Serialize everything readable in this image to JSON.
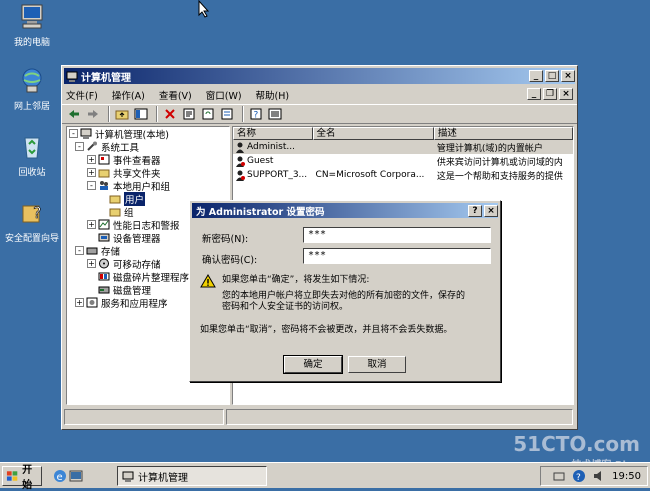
{
  "desktop": {
    "icons": [
      {
        "label": "我的电脑",
        "icon": "my-computer-icon"
      },
      {
        "label": "网上邻居",
        "icon": "network-icon"
      },
      {
        "label": "回收站",
        "icon": "recycle-bin-icon"
      },
      {
        "label": "安全配置向导",
        "icon": "security-wizard-icon"
      }
    ]
  },
  "window": {
    "title": "计算机管理",
    "menu": [
      "文件(F)",
      "操作(A)",
      "查看(V)",
      "窗口(W)",
      "帮助(H)"
    ]
  },
  "tree": {
    "items": [
      {
        "label": "计算机管理(本地)",
        "level": 0,
        "toggle": "-"
      },
      {
        "label": "系统工具",
        "level": 1,
        "toggle": "-"
      },
      {
        "label": "事件查看器",
        "level": 2,
        "toggle": "+"
      },
      {
        "label": "共享文件夹",
        "level": 2,
        "toggle": "+"
      },
      {
        "label": "本地用户和组",
        "level": 2,
        "toggle": "-"
      },
      {
        "label": "用户",
        "level": 3,
        "toggle": "",
        "selected": true
      },
      {
        "label": "组",
        "level": 3,
        "toggle": ""
      },
      {
        "label": "性能日志和警报",
        "level": 2,
        "toggle": "+"
      },
      {
        "label": "设备管理器",
        "level": 2,
        "toggle": ""
      },
      {
        "label": "存储",
        "level": 1,
        "toggle": "-"
      },
      {
        "label": "可移动存储",
        "level": 2,
        "toggle": "+"
      },
      {
        "label": "磁盘碎片整理程序",
        "level": 2,
        "toggle": ""
      },
      {
        "label": "磁盘管理",
        "level": 2,
        "toggle": ""
      },
      {
        "label": "服务和应用程序",
        "level": 1,
        "toggle": "+"
      }
    ]
  },
  "list": {
    "columns": [
      "名称",
      "全名",
      "描述"
    ],
    "rows": [
      {
        "name": "Administ...",
        "fullname": "",
        "desc": "管理计算机(域)的内置帐户"
      },
      {
        "name": "Guest",
        "fullname": "",
        "desc": "供来宾访问计算机或访问域的内"
      },
      {
        "name": "SUPPORT_3...",
        "fullname": "CN=Microsoft Corpora...",
        "desc": "这是一个帮助和支持服务的提供"
      }
    ]
  },
  "dialog": {
    "title": "为 Administrator 设置密码",
    "new_password_label": "新密码(N):",
    "new_password_value": "***",
    "confirm_password_label": "确认密码(C):",
    "confirm_password_value": "***",
    "warning_heading": "如果您单击“确定”，将发生如下情况:",
    "warning_body_1": "您的本地用户帐户将立即失去对他的所有加密的文件，保存的",
    "warning_body_2": "密码和个人安全证书的访问权。",
    "cancel_note": "如果您单击“取消”，密码将不会被更改，并且将不会丢失数据。",
    "ok_label": "确定",
    "cancel_label": "取消"
  },
  "taskbar": {
    "start_label": "开始",
    "task_label": "计算机管理",
    "clock": "19:50"
  },
  "watermark": {
    "line1": "51CTO.com",
    "line2": "技术博客 Blog"
  }
}
